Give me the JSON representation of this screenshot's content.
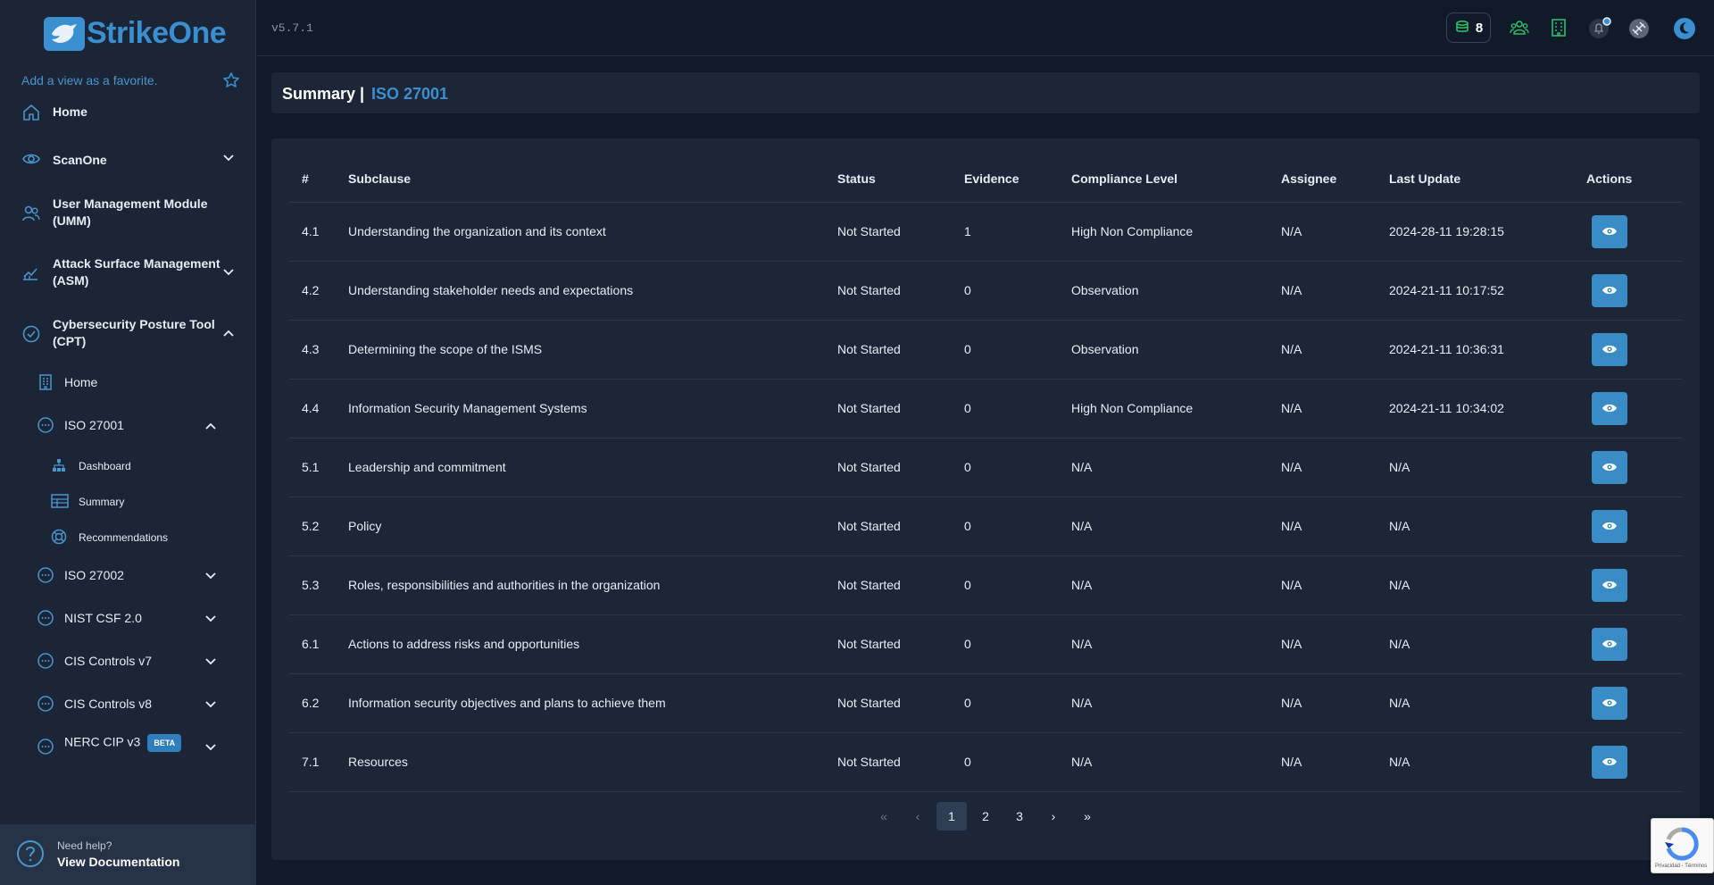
{
  "brand": {
    "name": "StrikeOne"
  },
  "sidebar": {
    "favorite_text": "Add a view as a favorite.",
    "items": [
      {
        "label": "Home",
        "icon": "home-icon"
      },
      {
        "label": "ScanOne",
        "icon": "eye-icon"
      },
      {
        "label": "User Management Module (UMM)",
        "icon": "users-icon"
      },
      {
        "label": "Attack Surface Management (ASM)",
        "icon": "chart-icon"
      },
      {
        "label": "Cybersecurity Posture Tool (CPT)",
        "icon": "check-circle-icon"
      }
    ],
    "cpt_children": [
      {
        "label": "Home",
        "icon": "building-icon"
      },
      {
        "label": "ISO 27001",
        "icon": "dots-circle-icon"
      },
      {
        "label": "ISO 27002",
        "icon": "dots-circle-icon"
      },
      {
        "label": "NIST CSF 2.0",
        "icon": "dots-circle-icon"
      },
      {
        "label": "CIS Controls v7",
        "icon": "dots-circle-icon"
      },
      {
        "label": "CIS Controls v8",
        "icon": "dots-circle-icon"
      },
      {
        "label": "NERC CIP v3",
        "icon": "dots-circle-icon",
        "badge": "BETA"
      }
    ],
    "iso27001_children": [
      {
        "label": "Dashboard",
        "icon": "sitemap-icon"
      },
      {
        "label": "Summary",
        "icon": "table-icon"
      },
      {
        "label": "Recommendations",
        "icon": "lifebuoy-icon"
      }
    ],
    "help": {
      "line1": "Need help?",
      "line2": "View Documentation"
    }
  },
  "header": {
    "version": "v5.7.1",
    "credits": "8"
  },
  "page": {
    "title": "Summary |",
    "subtitle": "ISO 27001"
  },
  "table": {
    "columns": [
      "#",
      "Subclause",
      "Status",
      "Evidence",
      "Compliance Level",
      "Assignee",
      "Last Update",
      "Actions"
    ],
    "rows": [
      [
        "4.1",
        "Understanding the organization and its context",
        "Not Started",
        "1",
        "High Non Compliance",
        "N/A",
        "2024-28-11 19:28:15"
      ],
      [
        "4.2",
        "Understanding stakeholder needs and expectations",
        "Not Started",
        "0",
        "Observation",
        "N/A",
        "2024-21-11 10:17:52"
      ],
      [
        "4.3",
        "Determining the scope of the ISMS",
        "Not Started",
        "0",
        "Observation",
        "N/A",
        "2024-21-11 10:36:31"
      ],
      [
        "4.4",
        "Information Security Management Systems",
        "Not Started",
        "0",
        "High Non Compliance",
        "N/A",
        "2024-21-11 10:34:02"
      ],
      [
        "5.1",
        "Leadership and commitment",
        "Not Started",
        "0",
        "N/A",
        "N/A",
        "N/A"
      ],
      [
        "5.2",
        "Policy",
        "Not Started",
        "0",
        "N/A",
        "N/A",
        "N/A"
      ],
      [
        "5.3",
        "Roles, responsibilities and authorities in the organization",
        "Not Started",
        "0",
        "N/A",
        "N/A",
        "N/A"
      ],
      [
        "6.1",
        "Actions to address risks and opportunities",
        "Not Started",
        "0",
        "N/A",
        "N/A",
        "N/A"
      ],
      [
        "6.2",
        "Information security objectives and plans to achieve them",
        "Not Started",
        "0",
        "N/A",
        "N/A",
        "N/A"
      ],
      [
        "7.1",
        "Resources",
        "Not Started",
        "0",
        "N/A",
        "N/A",
        "N/A"
      ]
    ]
  },
  "pagination": {
    "first": "«",
    "prev": "‹",
    "pages": [
      "1",
      "2",
      "3"
    ],
    "current": "1",
    "next": "›",
    "last": "»"
  },
  "recaptcha": {
    "label": "Privacidad - Términos"
  },
  "colors": {
    "accent": "#3a8fd0",
    "background": "#111a29",
    "panel": "#1c2637",
    "button": "#3a8cc7"
  }
}
